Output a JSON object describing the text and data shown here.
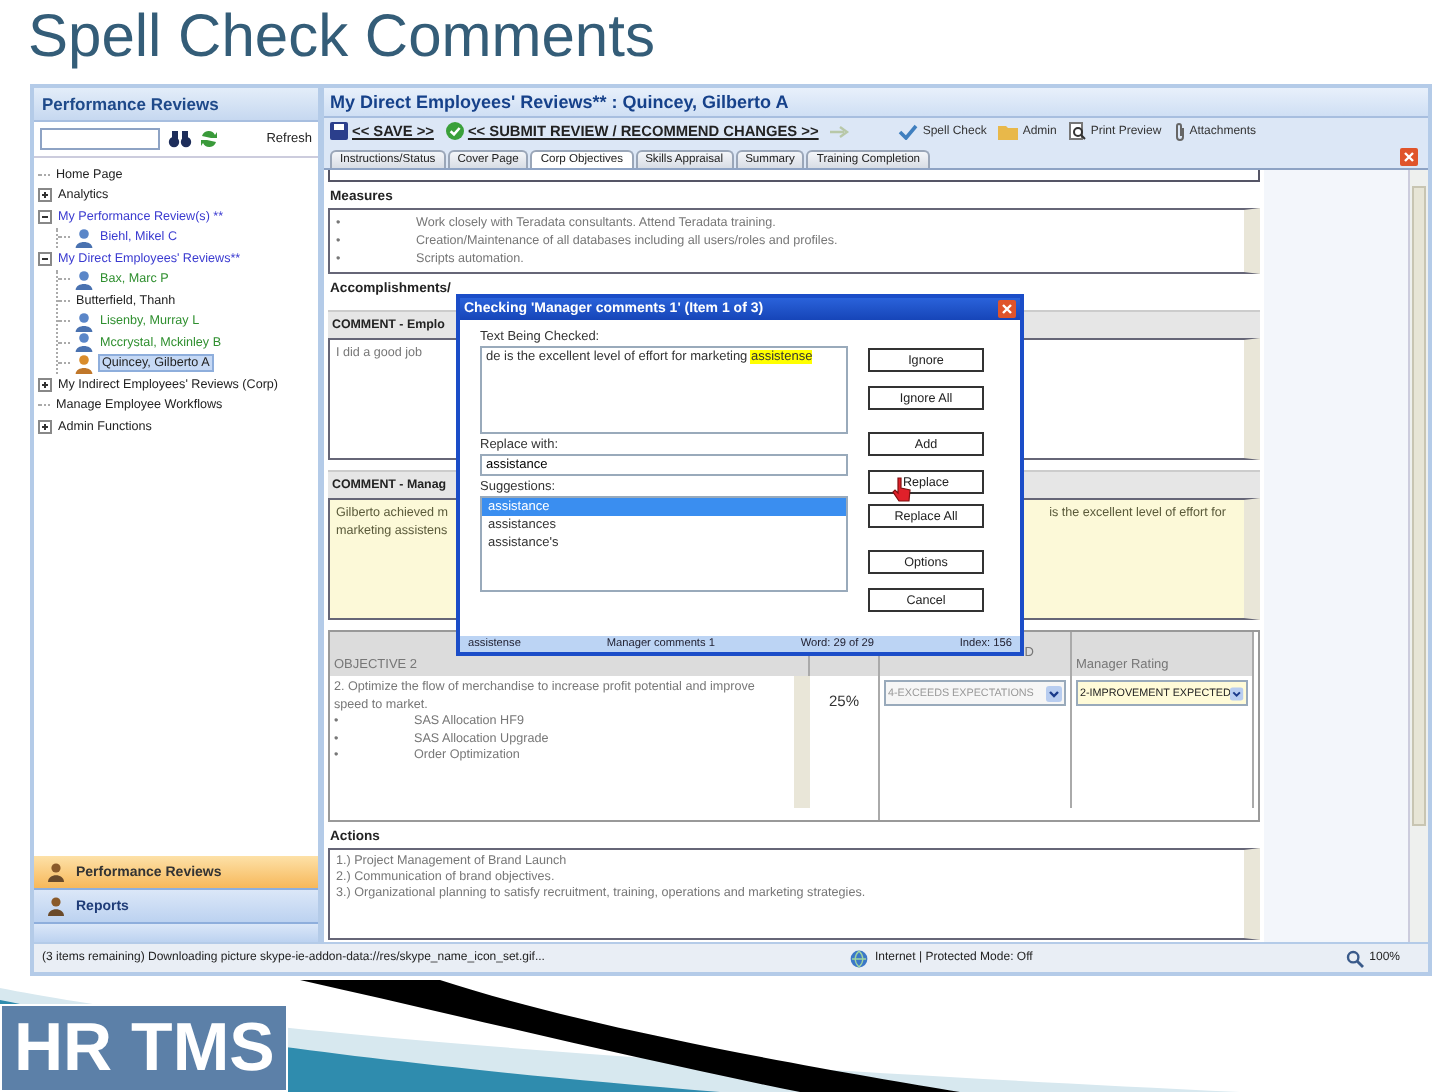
{
  "slide": {
    "title": "Spell Check Comments",
    "logo": "HR TMS"
  },
  "sidebar": {
    "title": "Performance Reviews",
    "refresh": "Refresh",
    "tree": [
      {
        "label": "Home Page",
        "kind": "page",
        "selected": false,
        "color": "#222222"
      },
      {
        "label": "Analytics",
        "kind": "group",
        "expanded": false,
        "selected": false,
        "color": "#222222"
      },
      {
        "label": "My Performance Review(s) **",
        "kind": "group",
        "expanded": true,
        "selected": false,
        "color": "#3a3ad0",
        "children": [
          {
            "label": "Biehl, Mikel C",
            "kind": "person",
            "selected": false,
            "color": "#3a3ad0"
          }
        ]
      },
      {
        "label": "My Direct Employees' Reviews**",
        "kind": "group",
        "expanded": true,
        "selected": false,
        "color": "#3a3ad0",
        "children": [
          {
            "label": "Bax, Marc P",
            "kind": "person",
            "selected": false,
            "color": "#2f8f2f"
          },
          {
            "label": "Butterfield, Thanh",
            "kind": "page",
            "selected": false,
            "color": "#222222"
          },
          {
            "label": "Lisenby, Murray L",
            "kind": "person",
            "selected": false,
            "color": "#2f8f2f"
          },
          {
            "label": "Mccrystal, Mckinley B",
            "kind": "person",
            "selected": false,
            "color": "#2f8f2f"
          },
          {
            "label": "Quincey, Gilberto A",
            "kind": "person",
            "selected": true,
            "color": "#222222"
          }
        ]
      },
      {
        "label": "My Indirect Employees' Reviews (Corp)",
        "kind": "group",
        "expanded": false,
        "selected": false,
        "color": "#222222"
      },
      {
        "label": "Manage Employee Workflows",
        "kind": "page",
        "selected": false,
        "color": "#222222"
      },
      {
        "label": "Admin Functions",
        "kind": "group",
        "expanded": false,
        "selected": false,
        "color": "#222222"
      }
    ],
    "nav": [
      {
        "label": "Performance Reviews",
        "selected": true
      },
      {
        "label": "Reports",
        "selected": false
      }
    ]
  },
  "main": {
    "title": "My Direct Employees' Reviews** : Quincey, Gilberto A",
    "toolbar": [
      {
        "label": "<< SAVE >>",
        "kind": "save"
      },
      {
        "label": "<< SUBMIT REVIEW / RECOMMEND CHANGES >>",
        "kind": "submit"
      },
      {
        "label": "Spell Check",
        "kind": "spell"
      },
      {
        "label": "Admin",
        "kind": "admin"
      },
      {
        "label": "Print Preview",
        "kind": "print"
      },
      {
        "label": "Attachments",
        "kind": "attach"
      }
    ],
    "tabs": [
      {
        "label": "Instructions/Status",
        "selected": false
      },
      {
        "label": "Cover Page",
        "selected": false
      },
      {
        "label": "Corp Objectives",
        "selected": true
      },
      {
        "label": "Skills Appraisal",
        "selected": false
      },
      {
        "label": "Summary",
        "selected": false
      },
      {
        "label": "Training Completion",
        "selected": false
      }
    ],
    "measures": {
      "heading": "Measures",
      "lines": [
        {
          "bullet": "•",
          "text": "Work closely with Teradata consultants. Attend Teradata training."
        },
        {
          "bullet": "•",
          "text": "Creation/Maintenance of all databases including all users/roles and profiles."
        },
        {
          "bullet": "•",
          "text": "Scripts automation."
        }
      ]
    },
    "accomplishments_heading": "Accomplishments/",
    "comments": [
      {
        "header": "COMMENT - Emplo",
        "editable": false,
        "left_lines": [
          "I did a good job"
        ]
      },
      {
        "header": "COMMENT - Manag",
        "editable": true,
        "left_lines": [
          "Gilberto achieved m",
          "marketing assistens"
        ],
        "right_lines": [
          "is the excellent level of effort for"
        ]
      }
    ],
    "objective": {
      "heading": "OBJECTIVE 2",
      "column_3": "D",
      "column_4": "Manager Rating",
      "text": "2.  Optimize the flow of merchandise to increase profit potential and improve speed to market.",
      "lines": [
        {
          "bullet": "•",
          "text": "SAS Allocation HF9"
        },
        {
          "bullet": "•",
          "text": "SAS Allocation Upgrade"
        },
        {
          "bullet": "•",
          "text": "Order Optimization"
        }
      ],
      "weight": "25%",
      "ratings": [
        {
          "value": "4-EXCEEDS EXPECTATIONS",
          "disabled": true
        },
        {
          "value": "2-IMPROVEMENT EXPECTED",
          "disabled": false
        }
      ]
    },
    "actions": {
      "heading": "Actions",
      "lines": [
        "1.)  Project Management of Brand Launch",
        "2.)  Communication of brand objectives.",
        "3.)  Organizational planning to satisfy recruitment, training, operations and marketing strategies."
      ]
    }
  },
  "dialog": {
    "title": "Checking  'Manager comments 1' (Item 1 of 3)",
    "checked_label": "Text Being Checked:",
    "checked_text": "de is the excellent level of effort for marketing ",
    "misspelled": "assistense",
    "replace_label": "Replace with:",
    "replace_value": "assistance",
    "suggestions_label": "Suggestions:",
    "suggestions": [
      {
        "label": "assistance",
        "selected": true
      },
      {
        "label": "assistances",
        "selected": false
      },
      {
        "label": "assistance's",
        "selected": false
      }
    ],
    "buttons": [
      "Ignore",
      "Ignore All",
      "Add",
      "Replace",
      "Replace All",
      "Options",
      "Cancel"
    ],
    "status": [
      "assistense",
      "Manager comments 1",
      "Word: 29 of 29",
      "Index: 156"
    ]
  },
  "status_bar": {
    "message": "(3 items remaining) Downloading picture skype-ie-addon-data://res/skype_name_icon_set.gif...",
    "zone": "Internet | Protected Mode: Off",
    "zoom": "100%"
  }
}
